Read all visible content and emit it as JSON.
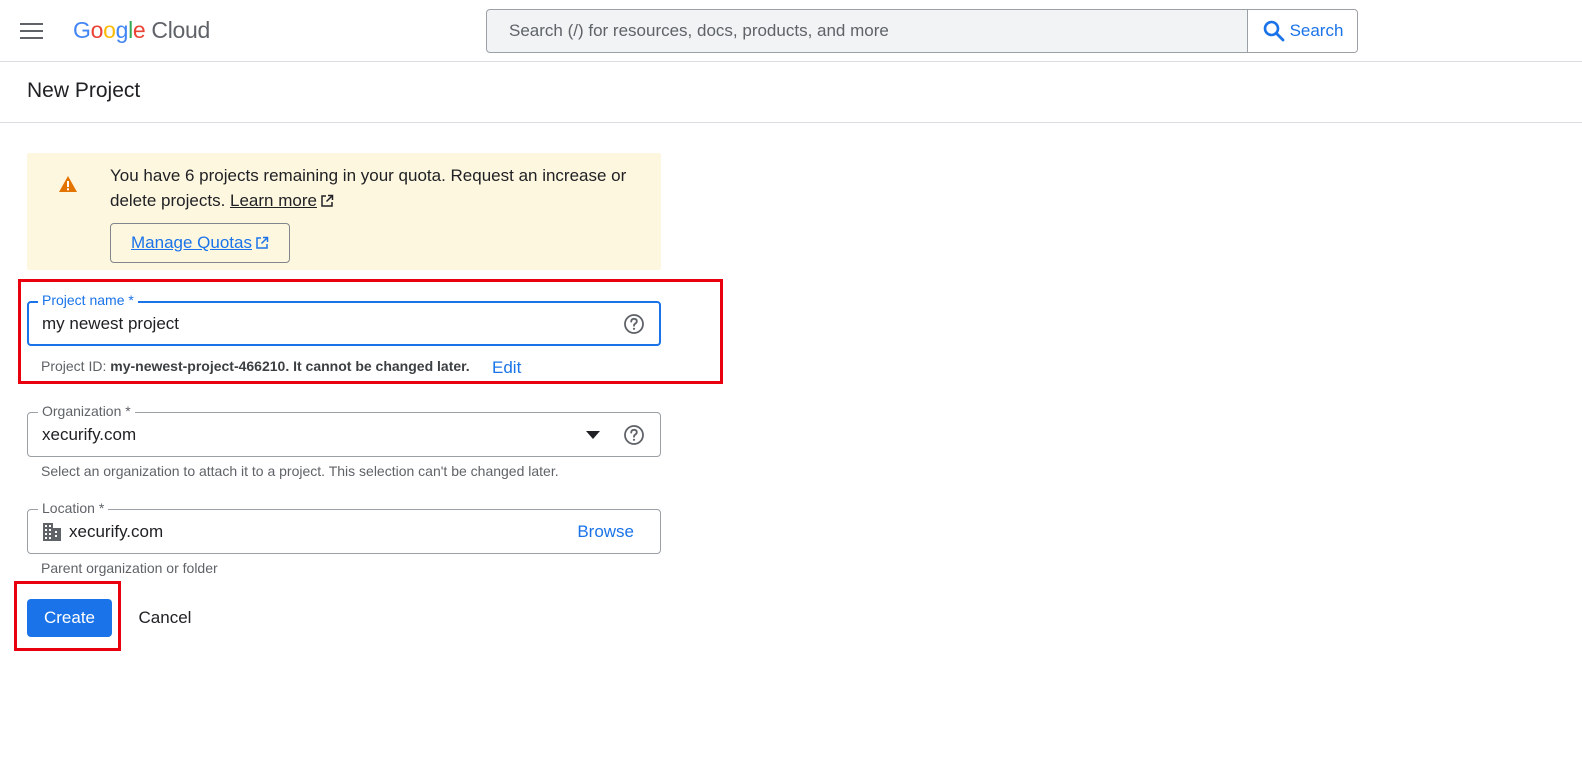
{
  "topbar": {
    "logo_letters": [
      "G",
      "o",
      "o",
      "g",
      "l",
      "e"
    ],
    "logo_product": "Cloud",
    "search_placeholder": "Search (/) for resources, docs, products, and more",
    "search_button_label": "Search"
  },
  "page": {
    "title": "New Project"
  },
  "banner": {
    "message": "You have 6 projects remaining in your quota. Request an increase or delete projects. ",
    "learn_more": "Learn more",
    "manage_quotas": "Manage Quotas"
  },
  "form": {
    "project_name": {
      "label": "Project name *",
      "value": "my newest project"
    },
    "project_id": {
      "prefix": "Project ID: ",
      "id": "my-newest-project-466210.",
      "suffix": " It cannot be changed later.",
      "edit_label": "Edit"
    },
    "organization": {
      "label": "Organization *",
      "value": "xecurify.com",
      "helper": "Select an organization to attach it to a project. This selection can't be changed later."
    },
    "location": {
      "label": "Location *",
      "value": "xecurify.com",
      "browse_label": "Browse",
      "helper": "Parent organization or folder"
    },
    "create_label": "Create",
    "cancel_label": "Cancel"
  },
  "colors": {
    "accent": "#1a73e8",
    "warning": "#e37400",
    "banner_bg": "#fef7e0",
    "highlight": "#e8000e"
  }
}
